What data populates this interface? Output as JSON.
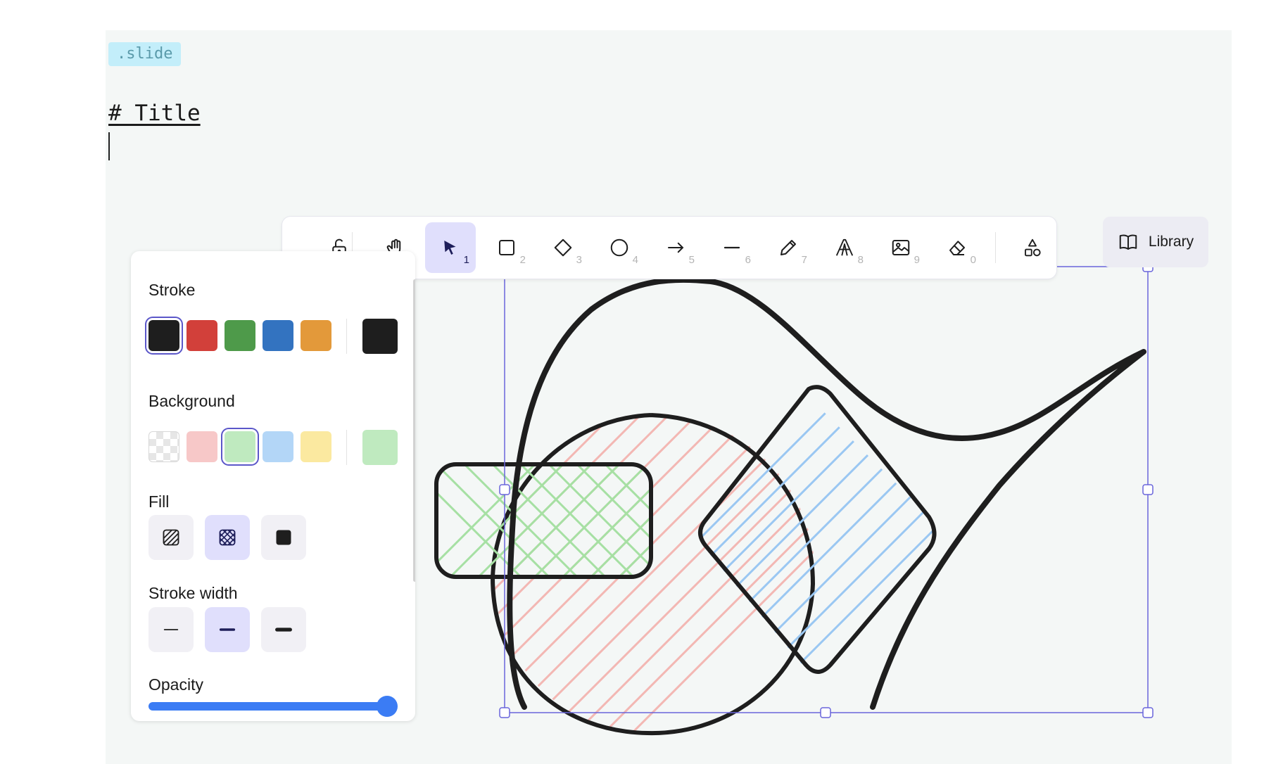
{
  "editor": {
    "tag": ".slide",
    "heading": "# Title"
  },
  "toolbar": {
    "tools": [
      {
        "name": "lock-icon",
        "key": ""
      },
      {
        "name": "hand-icon",
        "key": ""
      },
      {
        "name": "selection-icon",
        "key": "1"
      },
      {
        "name": "rectangle-icon",
        "key": "2"
      },
      {
        "name": "diamond-icon",
        "key": "3"
      },
      {
        "name": "ellipse-icon",
        "key": "4"
      },
      {
        "name": "arrow-icon",
        "key": "5"
      },
      {
        "name": "line-icon",
        "key": "6"
      },
      {
        "name": "pencil-icon",
        "key": "7"
      },
      {
        "name": "text-icon",
        "key": "8"
      },
      {
        "name": "image-icon",
        "key": "9"
      },
      {
        "name": "eraser-icon",
        "key": "0"
      },
      {
        "name": "more-shapes-icon",
        "key": ""
      }
    ],
    "active_tool": "selection-icon",
    "library_label": "Library"
  },
  "properties": {
    "stroke_label": "Stroke",
    "stroke_colors": [
      "#1e1e1e",
      "#d2403a",
      "#4e9a4a",
      "#3373c0",
      "#e3993a"
    ],
    "stroke_selected": "#1e1e1e",
    "background_label": "Background",
    "background_colors": [
      "transparent",
      "#f7c8c8",
      "#bfeabf",
      "#b3d6f7",
      "#fbe9a0"
    ],
    "background_selected": "#bfeabf",
    "fill_label": "Fill",
    "fill_options": [
      "hachure",
      "cross-hatch",
      "solid"
    ],
    "fill_selected": "cross-hatch",
    "stroke_width_label": "Stroke width",
    "stroke_width_options": [
      "thin",
      "bold",
      "extra-bold"
    ],
    "stroke_width_selected": "bold",
    "opacity_label": "Opacity",
    "opacity": 100
  }
}
